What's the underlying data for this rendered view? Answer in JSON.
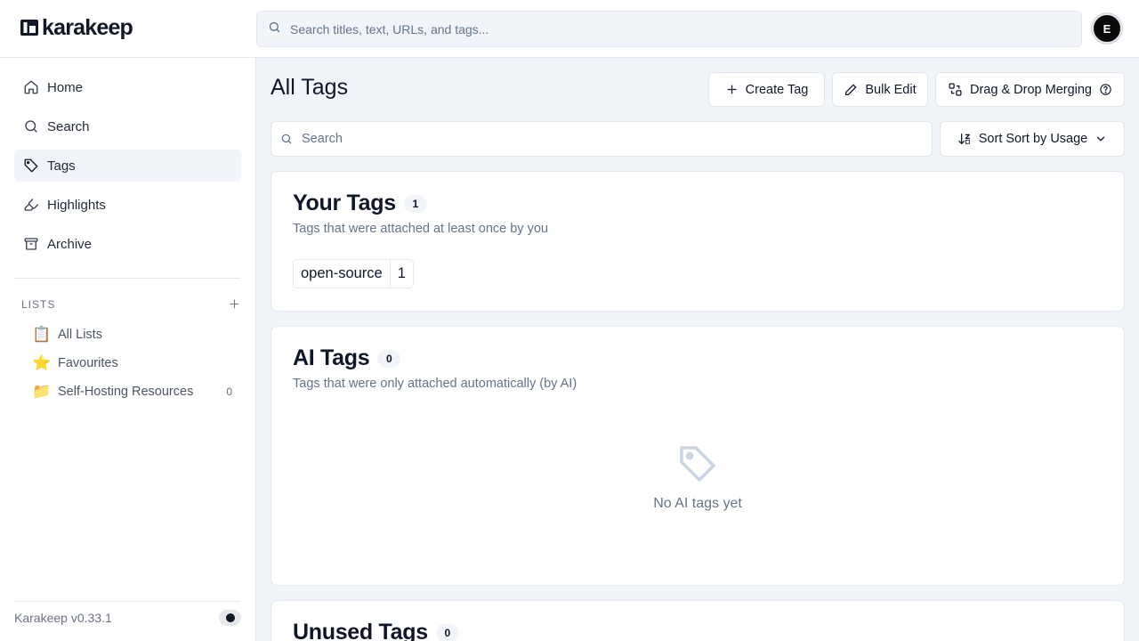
{
  "app": {
    "logo_text": "karakeep",
    "version": "Karakeep v0.33.1",
    "user_initial": "E"
  },
  "header": {
    "search_placeholder": "Search titles, text, URLs, and tags..."
  },
  "sidebar": {
    "nav": [
      {
        "label": "Home",
        "icon": "home-icon"
      },
      {
        "label": "Search",
        "icon": "search-icon"
      },
      {
        "label": "Tags",
        "icon": "tag-icon",
        "active": true
      },
      {
        "label": "Highlights",
        "icon": "highlighter-icon"
      },
      {
        "label": "Archive",
        "icon": "archive-icon"
      }
    ],
    "lists_title": "LISTS",
    "lists": [
      {
        "emoji": "📋",
        "label": "All Lists",
        "count": ""
      },
      {
        "emoji": "⭐",
        "label": "Favourites",
        "count": ""
      },
      {
        "emoji": "📁",
        "label": "Self-Hosting Resources",
        "count": "0"
      }
    ]
  },
  "main": {
    "title": "All Tags",
    "buttons": {
      "create": "Create Tag",
      "bulk_edit": "Bulk Edit",
      "merge": "Drag & Drop Merging"
    },
    "tag_search_placeholder": "Search",
    "sort_label": "Sort Sort by Usage",
    "sections": {
      "your_tags": {
        "title": "Your Tags",
        "count": "1",
        "description": "Tags that were attached at least once by you",
        "tags": [
          {
            "name": "open-source",
            "count": "1"
          }
        ]
      },
      "ai_tags": {
        "title": "AI Tags",
        "count": "0",
        "description": "Tags that were only attached automatically (by AI)",
        "empty_text": "No AI tags yet"
      },
      "unused_tags": {
        "title": "Unused Tags",
        "count": "0"
      }
    }
  }
}
